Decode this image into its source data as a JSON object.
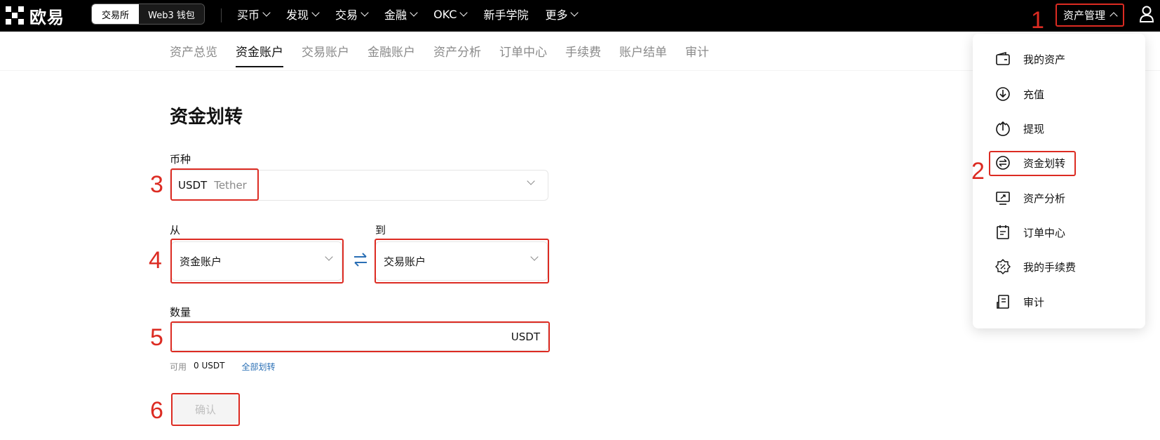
{
  "brand": {
    "name": "欧易"
  },
  "header": {
    "segment": [
      "交易所",
      "Web3 钱包"
    ],
    "nav": [
      {
        "label": "买币",
        "dropdown": true
      },
      {
        "label": "发现",
        "dropdown": true
      },
      {
        "label": "交易",
        "dropdown": true
      },
      {
        "label": "金融",
        "dropdown": true
      },
      {
        "label": "OKC",
        "dropdown": true
      },
      {
        "label": "新手学院",
        "dropdown": false
      },
      {
        "label": "更多",
        "dropdown": true
      }
    ],
    "asset_management": "资产管理",
    "user_icon": "user-icon"
  },
  "subtabs": [
    "资产总览",
    "资金账户",
    "交易账户",
    "金融账户",
    "资产分析",
    "订单中心",
    "手续费",
    "账户结单",
    "审计"
  ],
  "active_subtab": "资金账户",
  "form": {
    "title": "资金划转",
    "coin_label": "币种",
    "coin_value": "USDT",
    "coin_name": "Tether",
    "from_label": "从",
    "from_value": "资金账户",
    "to_label": "到",
    "to_value": "交易账户",
    "amount_label": "数量",
    "amount_unit": "USDT",
    "available_label": "可用",
    "available_value": "0 USDT",
    "transfer_all": "全部划转",
    "confirm": "确认"
  },
  "dropdown_menu": [
    {
      "label": "我的资产",
      "icon": "wallet-icon"
    },
    {
      "label": "充值",
      "icon": "deposit-icon"
    },
    {
      "label": "提现",
      "icon": "withdraw-icon"
    },
    {
      "label": "资金划转",
      "icon": "transfer-icon"
    },
    {
      "label": "资产分析",
      "icon": "analysis-icon"
    },
    {
      "label": "订单中心",
      "icon": "order-icon"
    },
    {
      "label": "我的手续费",
      "icon": "fee-icon"
    },
    {
      "label": "审计",
      "icon": "audit-icon"
    }
  ],
  "annotations": [
    "1",
    "2",
    "3",
    "4",
    "5",
    "6"
  ],
  "colors": {
    "accent_red": "#dc2b22",
    "link": "#2a6fb5",
    "swap": "#2a6fb5"
  }
}
